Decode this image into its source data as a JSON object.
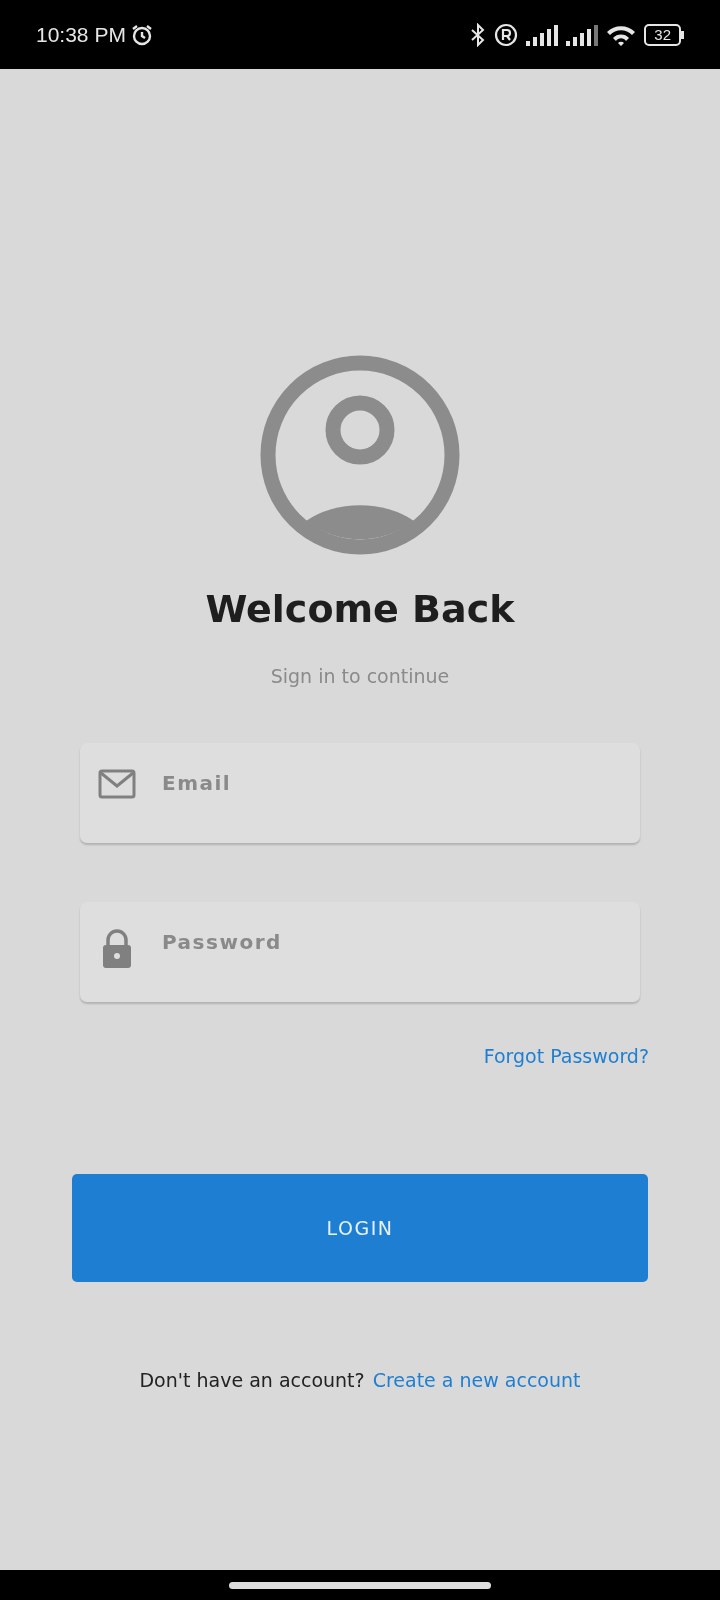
{
  "status_bar": {
    "time": "10:38 PM",
    "battery": "32"
  },
  "title": "Welcome Back",
  "subtitle": "Sign in to continue",
  "fields": [
    {
      "kind": "email",
      "placeholder": "Email"
    },
    {
      "kind": "password",
      "placeholder": "Password"
    }
  ],
  "forgot_link": "Forgot Password?",
  "login_button": "LOGIN",
  "signup_prompt": {
    "text": "Don't have an account?",
    "link": "Create a new account"
  }
}
